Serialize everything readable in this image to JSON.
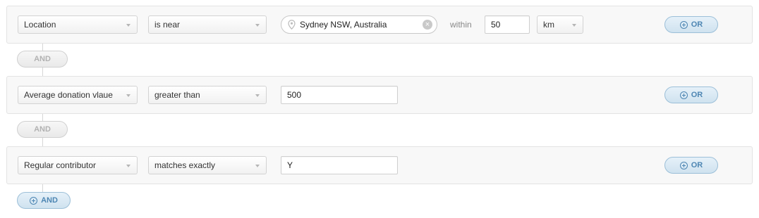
{
  "rules": [
    {
      "field": "Location",
      "operator": "is near",
      "location_value": "Sydney NSW, Australia",
      "within_label": "within",
      "distance": "50",
      "unit": "km",
      "or_label": "OR"
    },
    {
      "field": "Average donation vlaue",
      "operator": "greater than",
      "value": "500",
      "or_label": "OR"
    },
    {
      "field": "Regular contributor",
      "operator": "matches exactly",
      "value": "Y",
      "or_label": "OR"
    }
  ],
  "and_connectors": [
    "AND",
    "AND"
  ],
  "add_and_label": "AND",
  "icons": {
    "location_pin": "map-pin-icon",
    "clear": "clear-circle-icon",
    "add": "plus-circle-icon",
    "dropdown": "chevron-down-icon"
  },
  "colors": {
    "accent": "#4d86b3",
    "pill_bg": "#d8e8f3",
    "row_bg": "#f8f8f8",
    "and_text": "#b2b2b2"
  }
}
